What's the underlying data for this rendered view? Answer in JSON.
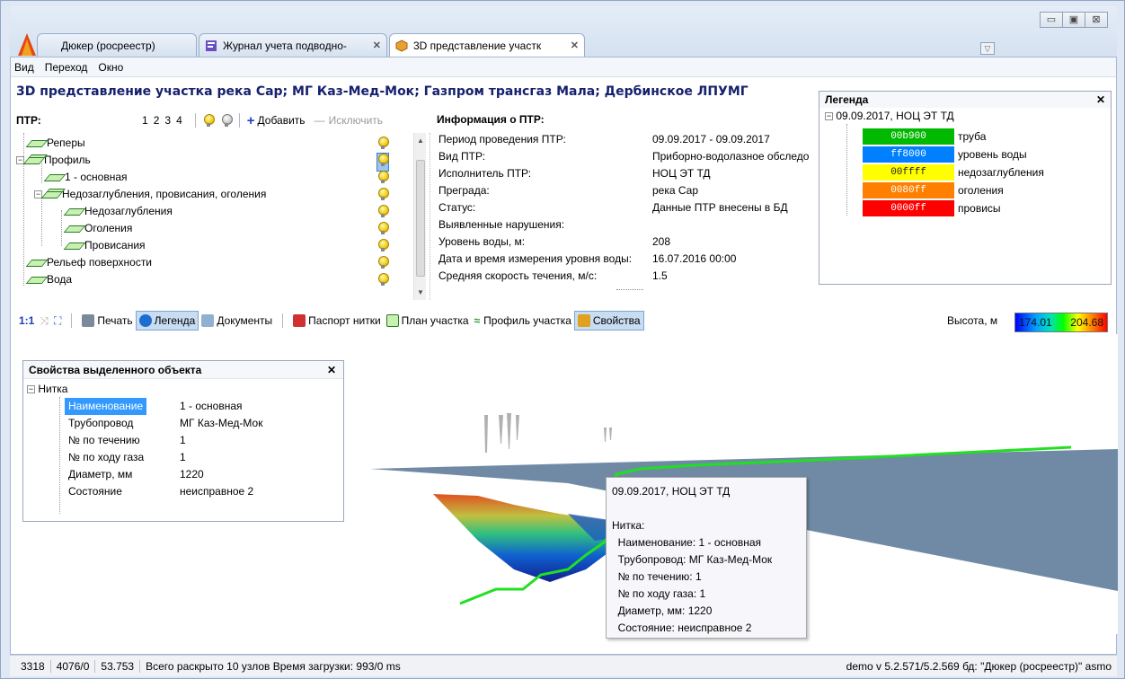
{
  "tabs": [
    {
      "label": "Дюкер (росреестр)"
    },
    {
      "label": "Журнал учета подводно-"
    },
    {
      "label": "3D представление участк"
    }
  ],
  "window_buttons": {
    "minimize": "▭",
    "maximize": "▣",
    "close": "⊠"
  },
  "menu": [
    "Вид",
    "Переход",
    "Окно"
  ],
  "page_title": "3D представление участка река Сар; МГ Каз-Мед-Мок; Газпром трансгаз Мала; Дербинское ЛПУМГ",
  "ptr": {
    "label": "ПТР:",
    "pages": [
      "1",
      "2",
      "3",
      "4"
    ],
    "add_label": "Добавить",
    "remove_label": "Исключить",
    "tree": [
      {
        "label": "Реперы"
      },
      {
        "label": "Профиль"
      },
      {
        "label": "1 - основная"
      },
      {
        "label": "Недозаглубления, провисания, оголения"
      },
      {
        "label": "Недозаглубления"
      },
      {
        "label": "Оголения"
      },
      {
        "label": "Провисания"
      },
      {
        "label": "Рельеф поверхности"
      },
      {
        "label": "Вода"
      }
    ]
  },
  "info": {
    "title": "Информация о ПТР:",
    "rows": [
      {
        "k": "Период проведения ПТР:",
        "v": "09.09.2017 - 09.09.2017"
      },
      {
        "k": "Вид ПТР:",
        "v": "Приборно-водолазное обследо"
      },
      {
        "k": "Исполнитель ПТР:",
        "v": "НОЦ ЭТ ТД"
      },
      {
        "k": "Преграда:",
        "v": "река Сар"
      },
      {
        "k": "Статус:",
        "v": "Данные ПТР внесены в БД"
      },
      {
        "k": "Выявленные нарушения:",
        "v": ""
      },
      {
        "k": "Уровень воды, м:",
        "v": "208"
      },
      {
        "k": "Дата и время измерения уровня воды:",
        "v": "16.07.2016 00:00"
      },
      {
        "k": "Средняя скорость течения, м/с:",
        "v": "1.5"
      }
    ]
  },
  "legend": {
    "title": "Легенда",
    "root": "09.09.2017, НОЦ ЭТ ТД",
    "items": [
      {
        "code": "00b900",
        "label": "труба",
        "color": "#00b900"
      },
      {
        "code": "ff8000",
        "label": "уровень воды",
        "color": "#0080ff"
      },
      {
        "code": "00ffff",
        "label": "недозаглубления",
        "color": "#ffff00"
      },
      {
        "code": "0080ff",
        "label": "оголения",
        "color": "#ff8000"
      },
      {
        "code": "0000ff",
        "label": "провисы",
        "color": "#ff0000"
      }
    ]
  },
  "toolbar": {
    "scale": "1:1",
    "print": "Печать",
    "legend": "Легенда",
    "documents": "Документы",
    "passport": "Паспорт нитки",
    "plan": "План участка",
    "profile": "Профиль участка",
    "properties": "Свойства",
    "height_label": "Высота, м",
    "height_min": "174.01",
    "height_max": "204.68"
  },
  "props": {
    "title": "Свойства выделенного объекта",
    "root": "Нитка",
    "rows": [
      {
        "k": "Наименование",
        "v": "1 - основная"
      },
      {
        "k": "Трубопровод",
        "v": "МГ Каз-Мед-Мок"
      },
      {
        "k": "№ по течению",
        "v": "1"
      },
      {
        "k": "№ по ходу газа",
        "v": "1"
      },
      {
        "k": "Диаметр, мм",
        "v": "1220"
      },
      {
        "k": "Состояние",
        "v": "неисправное 2"
      }
    ]
  },
  "tooltip": {
    "lines": [
      "09.09.2017, НОЦ ЭТ ТД",
      "",
      "Нитка:",
      "  Наименование: 1 - основная",
      "  Трубопровод: МГ Каз-Мед-Мок",
      "  № по течению: 1",
      "  № по ходу газа: 1",
      "  Диаметр, мм: 1220",
      "  Состояние: неисправное 2"
    ]
  },
  "status": {
    "a": "3318",
    "b": "4076/0",
    "c": "53.753",
    "d": "Всего раскрыто 10 узлов  Время загрузки: 993/0 ms",
    "right": "demo  v 5.2.571/5.2.569  бд: \"Дюкер (росреестр)\" asmo"
  }
}
